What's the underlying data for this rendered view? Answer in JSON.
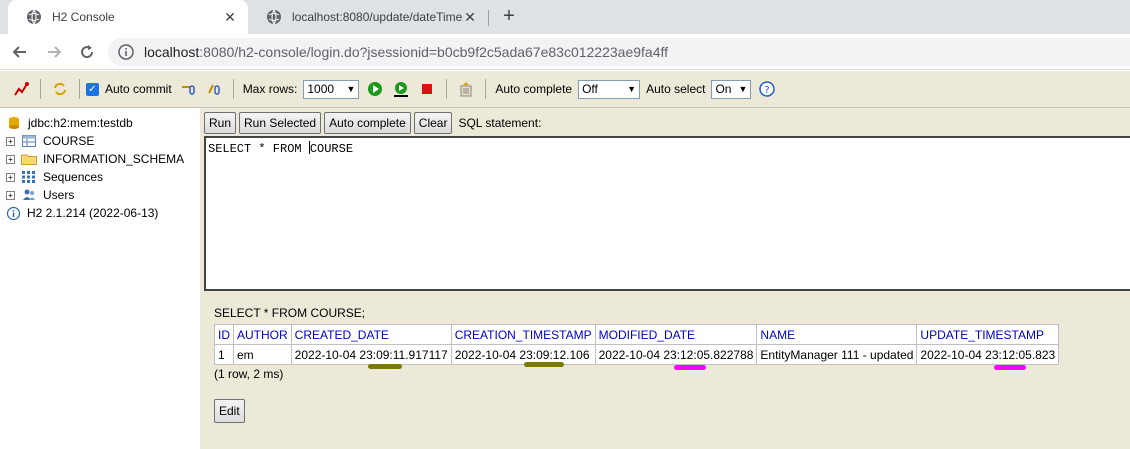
{
  "browser": {
    "tabs": [
      {
        "title": "H2 Console",
        "active": true
      },
      {
        "title": "localhost:8080/update/dateTime",
        "active": false
      }
    ],
    "close_glyph": "✕",
    "newtab_glyph": "+",
    "url_host": "localhost",
    "url_rest": ":8080/h2-console/login.do?jsessionid=b0cb9f2c5ada67e83c012223ae9fa4ff"
  },
  "toolbar": {
    "auto_commit_label": "Auto commit",
    "auto_commit_checked": true,
    "max_rows_label": "Max rows:",
    "max_rows_value": "1000",
    "auto_complete_label": "Auto complete",
    "auto_complete_value": "Off",
    "auto_select_label": "Auto select",
    "auto_select_value": "On"
  },
  "tree": {
    "connection": "jdbc:h2:mem:testdb",
    "items": [
      {
        "label": "COURSE",
        "icon": "table-icon"
      },
      {
        "label": "INFORMATION_SCHEMA",
        "icon": "folder-icon"
      },
      {
        "label": "Sequences",
        "icon": "sequences-icon"
      },
      {
        "label": "Users",
        "icon": "users-icon"
      }
    ],
    "version": "H2 2.1.214 (2022-06-13)"
  },
  "query": {
    "buttons": {
      "run": "Run",
      "run_selected": "Run Selected",
      "auto_complete": "Auto complete",
      "clear": "Clear"
    },
    "sql_label": "SQL statement:",
    "sql_before_caret": "SELECT * FROM ",
    "sql_after_caret": "COURSE"
  },
  "result": {
    "sql": "SELECT * FROM COURSE;",
    "columns": [
      "ID",
      "AUTHOR",
      "CREATED_DATE",
      "CREATION_TIMESTAMP",
      "MODIFIED_DATE",
      "NAME",
      "UPDATE_TIMESTAMP"
    ],
    "rows": [
      [
        "1",
        "em",
        "2022-10-04 23:09:11.917117",
        "2022-10-04 23:09:12.106",
        "2022-10-04 23:12:05.822788",
        "EntityManager 111 - updated",
        "2022-10-04 23:12:05.823"
      ]
    ],
    "info": "(1 row, 2 ms)",
    "edit_label": "Edit"
  },
  "colors": {
    "highlight_olive": "#7a7a00",
    "highlight_magenta": "#ff00ff",
    "h2_background": "#ece9d8",
    "header_link": "#0000cc"
  }
}
